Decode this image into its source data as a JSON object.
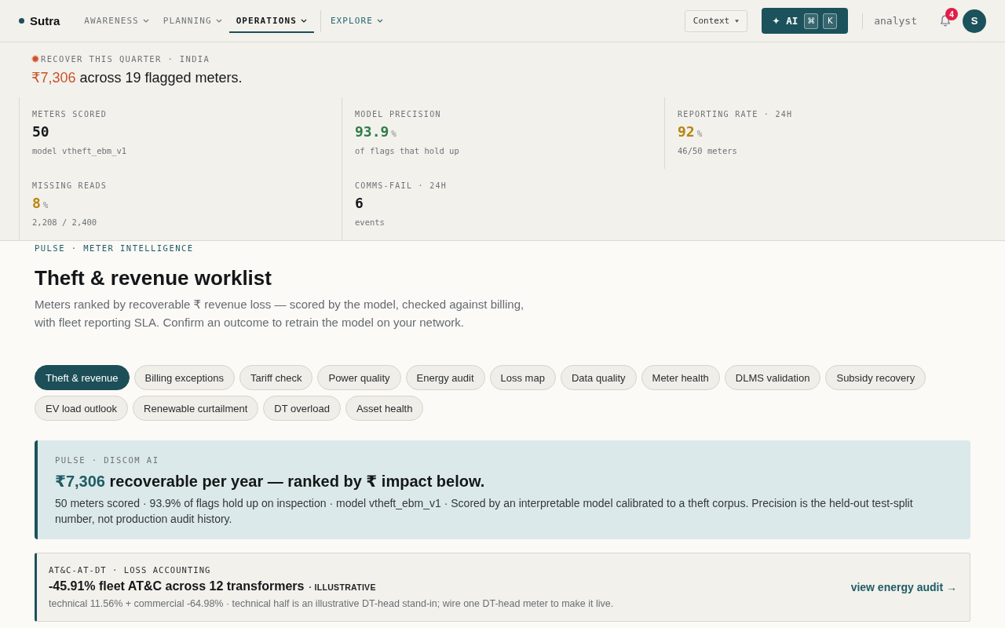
{
  "nav": {
    "brand": "Sutra",
    "menus": [
      {
        "label": "AWARENESS",
        "selected": false
      },
      {
        "label": "PLANNING",
        "selected": false
      },
      {
        "label": "OPERATIONS",
        "selected": true
      }
    ],
    "explore": "EXPLORE",
    "context_button": "Context",
    "ai_button": {
      "label": "AI",
      "keys": [
        "⌘",
        "K"
      ]
    },
    "user_role": "analyst",
    "notifications": "4",
    "avatar": "S"
  },
  "hero": {
    "eyebrow": "RECOVER THIS QUARTER · INDIA",
    "amount": "₹7,306",
    "headline": "across 19 flagged meters.",
    "kpis": [
      {
        "label": "METERS SCORED",
        "value": "50",
        "color": "#15191c",
        "caption": "model vtheft_ebm_v1"
      },
      {
        "label": "MODEL PRECISION",
        "value": "93.9",
        "unit": "%",
        "color": "#2e7d4a",
        "caption": "of flags that hold up"
      },
      {
        "label": "REPORTING RATE · 24H",
        "value": "92",
        "unit": "%",
        "color": "#b8860f",
        "caption": "46/50 meters"
      },
      {
        "label": "MISSING READS",
        "value": "8",
        "unit": "%",
        "color": "#b8860f",
        "caption": "2,208 / 2,400"
      },
      {
        "label": "COMMS-FAIL · 24H",
        "value": "6",
        "color": "#15191c",
        "caption": "events"
      }
    ]
  },
  "section": {
    "eyebrow": "PULSE · METER INTELLIGENCE",
    "title": "Theft & revenue worklist",
    "description": "Meters ranked by recoverable ₹ revenue loss — scored by the model, checked against billing, with fleet reporting SLA. Confirm an outcome to retrain the model on your network."
  },
  "tabs": [
    {
      "label": "Theft & revenue",
      "selected": true
    },
    {
      "label": "Billing exceptions",
      "selected": false
    },
    {
      "label": "Tariff check",
      "selected": false
    },
    {
      "label": "Power quality",
      "selected": false
    },
    {
      "label": "Energy audit",
      "selected": false
    },
    {
      "label": "Loss map",
      "selected": false
    },
    {
      "label": "Data quality",
      "selected": false
    },
    {
      "label": "Meter health",
      "selected": false
    },
    {
      "label": "DLMS validation",
      "selected": false
    },
    {
      "label": "Subsidy recovery",
      "selected": false
    },
    {
      "label": "EV load outlook",
      "selected": false
    },
    {
      "label": "Renewable curtailment",
      "selected": false
    },
    {
      "label": "DT overload",
      "selected": false
    },
    {
      "label": "Asset health",
      "selected": false
    }
  ],
  "insight": {
    "eyebrow": "PULSE · DISCOM AI",
    "amount": "₹7,306",
    "headline": "recoverable per year — ranked by ₹ impact below.",
    "body": "50 meters scored · 93.9% of flags hold up on inspection · model vtheft_ebm_v1 · Scored by an interpretable model calibrated to a theft corpus. Precision is the held-out test-split number, not production audit history."
  },
  "loss_card": {
    "eyebrow": "AT&C-AT-DT · LOSS ACCOUNTING",
    "headline": "-45.91% fleet AT&C across 12 transformers",
    "tag": "· ILLUSTRATIVE",
    "note": "technical 11.56% + commercial -64.98% · technical half is an illustrative DT-head stand-in; wire one DT-head meter to make it live.",
    "link": "view energy audit →"
  }
}
